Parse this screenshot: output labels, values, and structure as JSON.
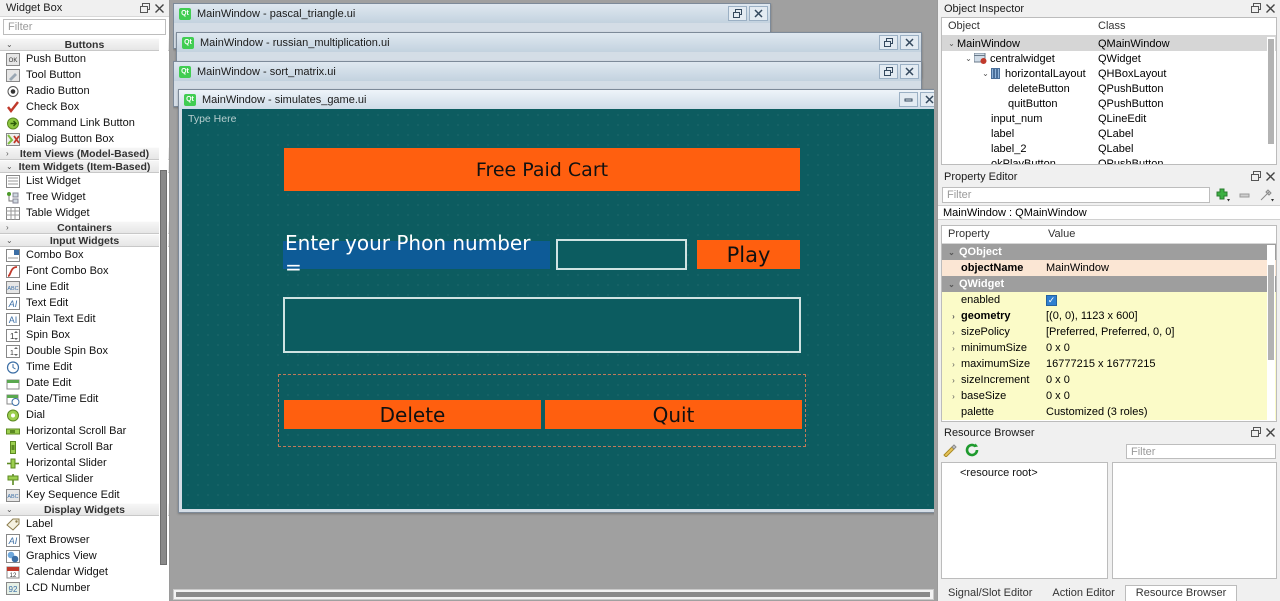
{
  "widget_box": {
    "title": "Widget Box",
    "filter_placeholder": "Filter",
    "groups": [
      {
        "name": "Buttons",
        "expanded": true,
        "items": [
          {
            "label": "Push Button",
            "icon": "push-button-icon"
          },
          {
            "label": "Tool Button",
            "icon": "tool-button-icon"
          },
          {
            "label": "Radio Button",
            "icon": "radio-button-icon"
          },
          {
            "label": "Check Box",
            "icon": "check-box-icon"
          },
          {
            "label": "Command Link Button",
            "icon": "command-link-button-icon"
          },
          {
            "label": "Dialog Button Box",
            "icon": "dialog-button-box-icon"
          }
        ]
      },
      {
        "name": "Item Views (Model-Based)",
        "expanded": false,
        "items": []
      },
      {
        "name": "Item Widgets (Item-Based)",
        "expanded": true,
        "items": [
          {
            "label": "List Widget",
            "icon": "list-widget-icon"
          },
          {
            "label": "Tree Widget",
            "icon": "tree-widget-icon"
          },
          {
            "label": "Table Widget",
            "icon": "table-widget-icon"
          }
        ]
      },
      {
        "name": "Containers",
        "expanded": false,
        "items": []
      },
      {
        "name": "Input Widgets",
        "expanded": true,
        "items": [
          {
            "label": "Combo Box",
            "icon": "combo-box-icon"
          },
          {
            "label": "Font Combo Box",
            "icon": "font-combo-box-icon"
          },
          {
            "label": "Line Edit",
            "icon": "line-edit-icon"
          },
          {
            "label": "Text Edit",
            "icon": "text-edit-icon"
          },
          {
            "label": "Plain Text Edit",
            "icon": "plain-text-edit-icon"
          },
          {
            "label": "Spin Box",
            "icon": "spin-box-icon"
          },
          {
            "label": "Double Spin Box",
            "icon": "double-spin-box-icon"
          },
          {
            "label": "Time Edit",
            "icon": "time-edit-icon"
          },
          {
            "label": "Date Edit",
            "icon": "date-edit-icon"
          },
          {
            "label": "Date/Time Edit",
            "icon": "date-time-edit-icon"
          },
          {
            "label": "Dial",
            "icon": "dial-icon"
          },
          {
            "label": "Horizontal Scroll Bar",
            "icon": "horizontal-scroll-bar-icon"
          },
          {
            "label": "Vertical Scroll Bar",
            "icon": "vertical-scroll-bar-icon"
          },
          {
            "label": "Horizontal Slider",
            "icon": "horizontal-slider-icon"
          },
          {
            "label": "Vertical Slider",
            "icon": "vertical-slider-icon"
          },
          {
            "label": "Key Sequence Edit",
            "icon": "key-sequence-edit-icon"
          }
        ]
      },
      {
        "name": "Display Widgets",
        "expanded": true,
        "items": [
          {
            "label": "Label",
            "icon": "label-icon"
          },
          {
            "label": "Text Browser",
            "icon": "text-browser-icon"
          },
          {
            "label": "Graphics View",
            "icon": "graphics-view-icon"
          },
          {
            "label": "Calendar Widget",
            "icon": "calendar-widget-icon"
          },
          {
            "label": "LCD Number",
            "icon": "lcd-number-icon"
          }
        ]
      }
    ]
  },
  "mdi": {
    "windows": [
      {
        "title": "MainWindow - pascal_triangle.ui",
        "buttons": [
          "restore",
          "close"
        ]
      },
      {
        "title": "MainWindow - russian_multiplication.ui",
        "buttons": [
          "restore",
          "close"
        ]
      },
      {
        "title": "MainWindow - sort_matrix.ui",
        "buttons": [
          "restore",
          "close"
        ]
      },
      {
        "title": "MainWindow - simulates_game.ui",
        "buttons": [
          "minimize",
          "close"
        ]
      }
    ],
    "form": {
      "type_here": "Type Here",
      "title_button": "Free Paid Cart",
      "prompt_label": "Enter your Phon number =",
      "play_button": "Play",
      "delete_button": "Delete",
      "quit_button": "Quit",
      "line_edit_value": "",
      "text_edit_value": ""
    }
  },
  "object_inspector": {
    "title": "Object Inspector",
    "columns": [
      "Object",
      "Class"
    ],
    "rows": [
      {
        "indent": 0,
        "chev": "v",
        "icon": "",
        "object": "MainWindow",
        "class": "QMainWindow",
        "selected": true
      },
      {
        "indent": 1,
        "chev": "v",
        "icon": "widget-icon",
        "object": "centralwidget",
        "class": "QWidget",
        "selected": false
      },
      {
        "indent": 2,
        "chev": "v",
        "icon": "hbox-icon",
        "object": "horizontalLayout",
        "class": "QHBoxLayout",
        "selected": false
      },
      {
        "indent": 3,
        "chev": "",
        "icon": "",
        "object": "deleteButton",
        "class": "QPushButton",
        "selected": false
      },
      {
        "indent": 3,
        "chev": "",
        "icon": "",
        "object": "quitButton",
        "class": "QPushButton",
        "selected": false
      },
      {
        "indent": 2,
        "chev": "",
        "icon": "",
        "object": "input_num",
        "class": "QLineEdit",
        "selected": false
      },
      {
        "indent": 2,
        "chev": "",
        "icon": "",
        "object": "label",
        "class": "QLabel",
        "selected": false
      },
      {
        "indent": 2,
        "chev": "",
        "icon": "",
        "object": "label_2",
        "class": "QLabel",
        "selected": false
      },
      {
        "indent": 2,
        "chev": "",
        "icon": "",
        "object": "okPlayButton",
        "class": "QPushButton",
        "selected": false
      }
    ]
  },
  "property_editor": {
    "title": "Property Editor",
    "filter_placeholder": "Filter",
    "object_line": "MainWindow : QMainWindow",
    "columns": [
      "Property",
      "Value"
    ],
    "rows": [
      {
        "kind": "group",
        "name": "QObject",
        "value": ""
      },
      {
        "kind": "peach",
        "name": "objectName",
        "value": "MainWindow",
        "bold": true
      },
      {
        "kind": "group",
        "name": "QWidget",
        "value": ""
      },
      {
        "kind": "yellow",
        "name": "enabled",
        "value": "",
        "checkbox": true
      },
      {
        "kind": "yellow",
        "name": "geometry",
        "value": "[(0, 0), 1123 x 600]",
        "bold": true,
        "expand": true
      },
      {
        "kind": "yellow",
        "name": "sizePolicy",
        "value": "[Preferred, Preferred, 0, 0]",
        "expand": true
      },
      {
        "kind": "yellow",
        "name": "minimumSize",
        "value": "0 x 0",
        "expand": true
      },
      {
        "kind": "yellow",
        "name": "maximumSize",
        "value": "16777215 x 16777215",
        "expand": true
      },
      {
        "kind": "yellow",
        "name": "sizeIncrement",
        "value": "0 x 0",
        "expand": true
      },
      {
        "kind": "yellow",
        "name": "baseSize",
        "value": "0 x 0",
        "expand": true
      },
      {
        "kind": "yellow",
        "name": "palette",
        "value": "Customized (3 roles)"
      }
    ]
  },
  "resource_browser": {
    "title": "Resource Browser",
    "filter_placeholder": "Filter",
    "root_label": "<resource root>",
    "tabs": [
      {
        "label": "Signal/Slot Editor",
        "active": false
      },
      {
        "label": "Action Editor",
        "active": false
      },
      {
        "label": "Resource Browser",
        "active": true
      }
    ]
  },
  "colors": {
    "form_background": "#0c5c60",
    "button_accent": "#ff5f0f",
    "label_highlight": "#0d5b97",
    "panel_background": "#f0f0f0",
    "mdi_background": "#a0a0a0",
    "qt_green": "#41cd52"
  }
}
